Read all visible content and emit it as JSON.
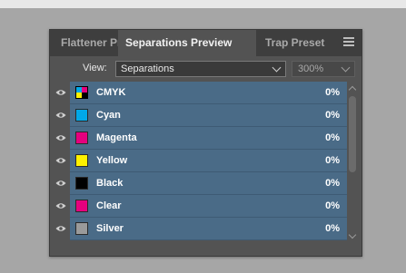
{
  "tabs": [
    {
      "label": "Flattener Preview"
    },
    {
      "label": "Separations Preview"
    },
    {
      "label": "Trap Presets"
    }
  ],
  "view": {
    "label": "View:",
    "value": "Separations",
    "zoom": "300%"
  },
  "inks": [
    {
      "name": "CMYK",
      "percent": "0%",
      "color": "multi"
    },
    {
      "name": "Cyan",
      "percent": "0%",
      "color": "#00a8e8"
    },
    {
      "name": "Magenta",
      "percent": "0%",
      "color": "#e6007e"
    },
    {
      "name": "Yellow",
      "percent": "0%",
      "color": "#fff200"
    },
    {
      "name": "Black",
      "percent": "0%",
      "color": "#000000"
    },
    {
      "name": "Clear",
      "percent": "0%",
      "color": "#e6007e"
    },
    {
      "name": "Silver",
      "percent": "0%",
      "color": "#9a9a9a"
    }
  ]
}
